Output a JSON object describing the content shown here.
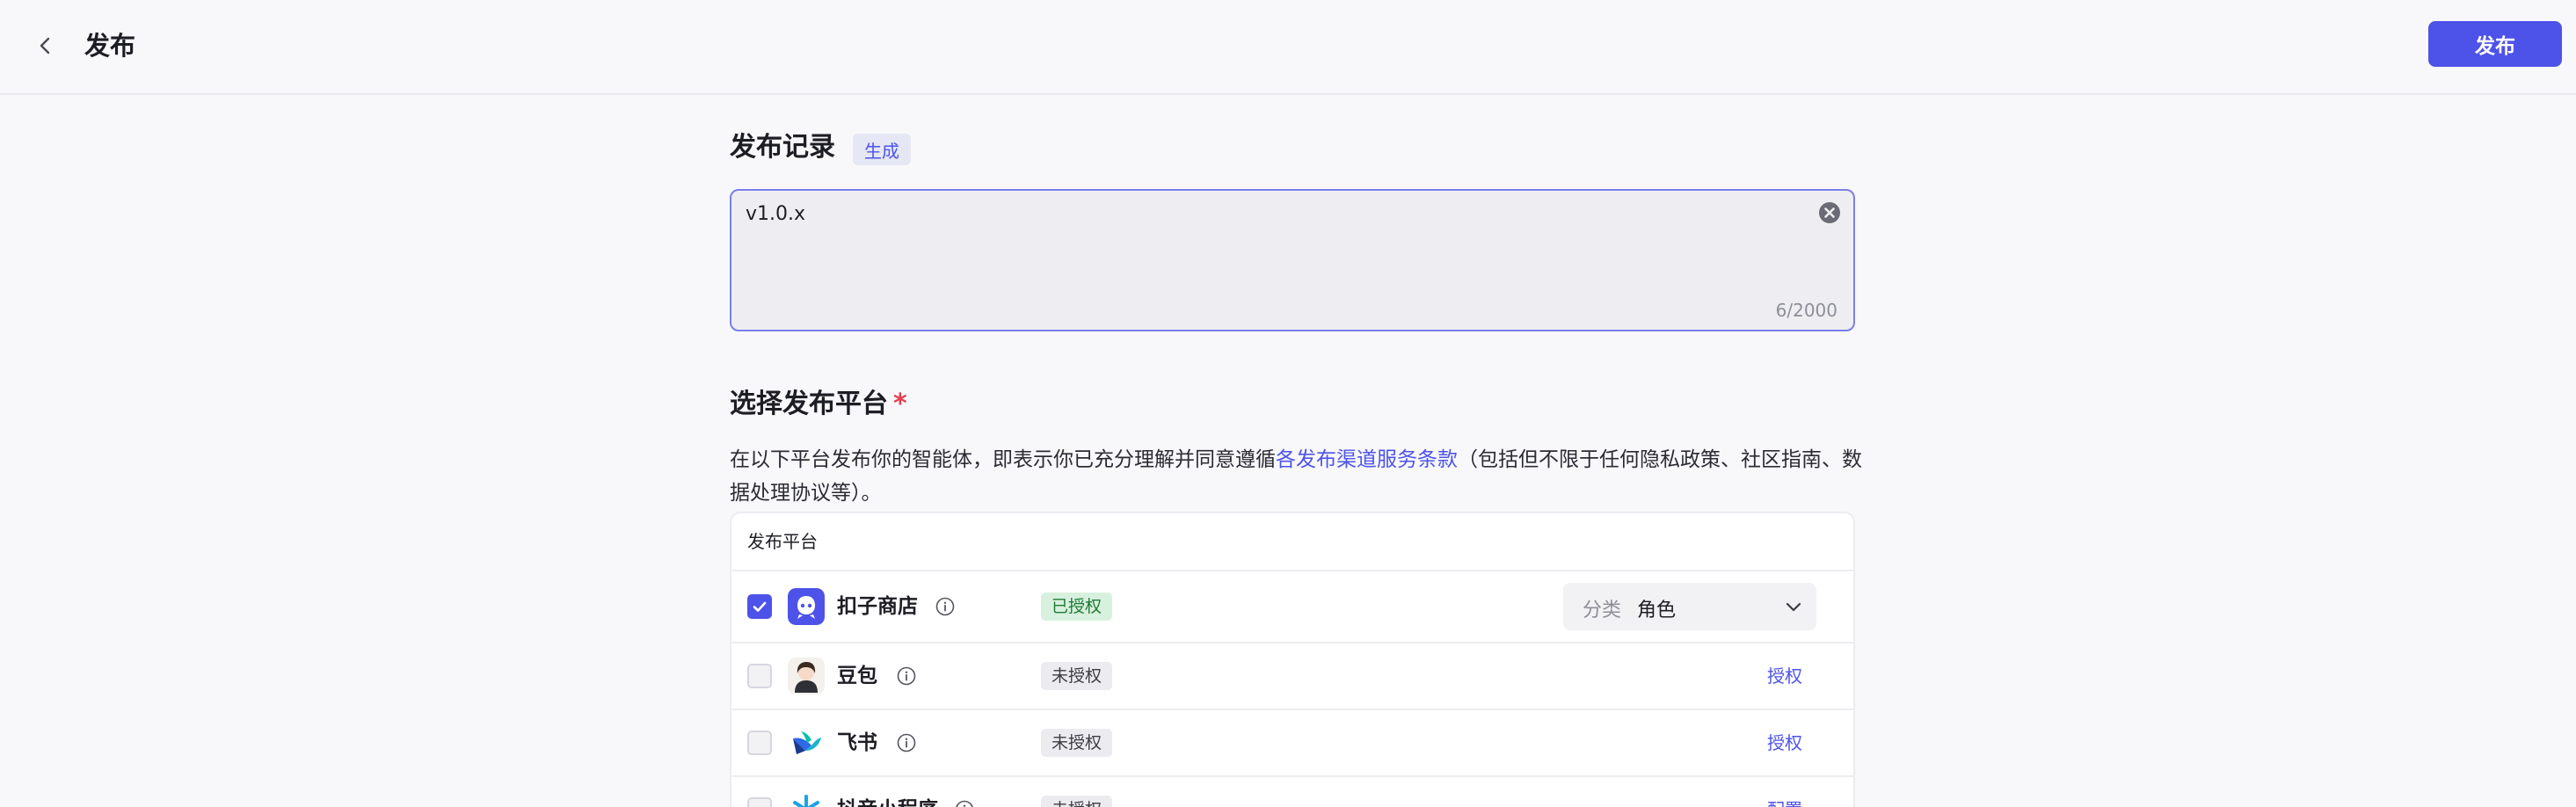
{
  "header": {
    "title": "发布",
    "publish_label": "发布"
  },
  "changelog": {
    "title": "发布记录",
    "generate_label": "生成",
    "value": "v1.0.x",
    "char_count": "6/2000"
  },
  "platforms": {
    "title": "选择发布平台",
    "required_mark": "*",
    "desc_before": "在以下平台发布你的智能体，即表示你已充分理解并同意遵循",
    "desc_link": "各发布渠道服务条款",
    "desc_after": "（包括但不限于任何隐私政策、社区指南、数据处理协议等）。",
    "table_header": "发布平台",
    "rows": [
      {
        "name": "扣子商店",
        "status": "已授权",
        "checked": true,
        "category_label": "分类",
        "category_value": "角色"
      },
      {
        "name": "豆包",
        "status": "未授权",
        "checked": false,
        "action": "授权"
      },
      {
        "name": "飞书",
        "status": "未授权",
        "checked": false,
        "action": "授权"
      },
      {
        "name": "抖音小程序",
        "status": "未授权",
        "checked": false,
        "action": "配置"
      }
    ]
  },
  "colors": {
    "accent": "#4d53e8",
    "authorized_bg": "#d8f1de",
    "unauthorized_bg": "#ececf0",
    "required": "#e53e4c"
  }
}
